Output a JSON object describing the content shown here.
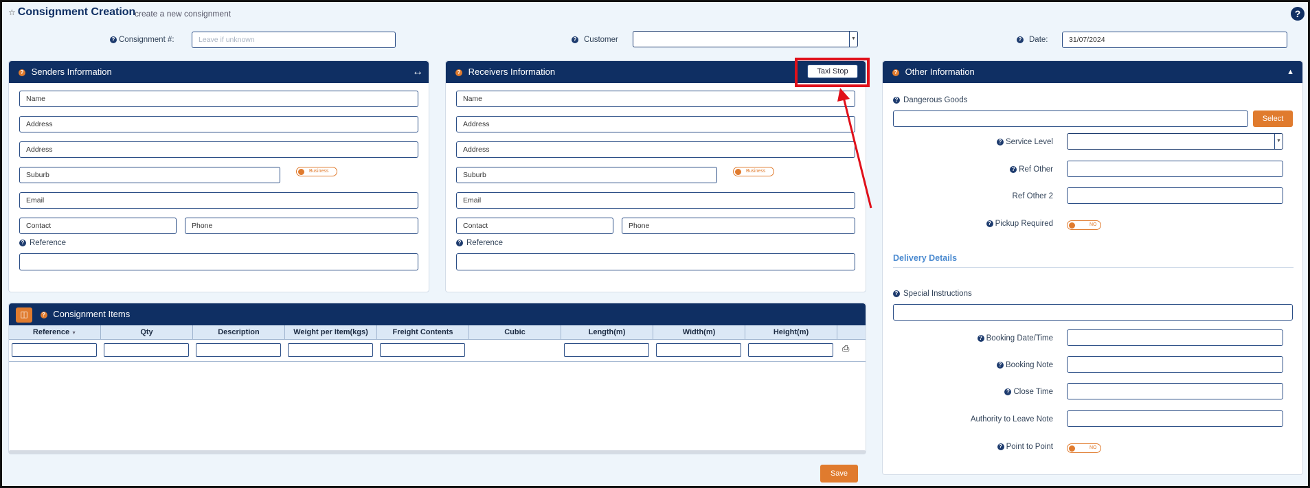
{
  "header": {
    "title": "Consignment Creation",
    "subtitle": "create a new consignment",
    "help": "?"
  },
  "top_fields": {
    "consignment_label": "Consignment #:",
    "consignment_placeholder": "Leave if unknown",
    "customer_label": "Customer",
    "customer_value": "",
    "date_label": "Date:",
    "date_value": "31/07/2024"
  },
  "senders": {
    "title": "Senders Information",
    "expand_icon": "↔",
    "name": "Name",
    "address1": "Address",
    "address2": "Address",
    "suburb": "Suburb",
    "business_toggle": "Business",
    "email": "Email",
    "contact": "Contact",
    "phone": "Phone",
    "reference_label": "Reference"
  },
  "receivers": {
    "title": "Receivers Information",
    "taxi_stop_button": "Taxi Stop",
    "name": "Name",
    "address1": "Address",
    "address2": "Address",
    "suburb": "Suburb",
    "business_toggle": "Business",
    "email": "Email",
    "contact": "Contact",
    "phone": "Phone",
    "reference_label": "Reference"
  },
  "other": {
    "title": "Other Information",
    "collapse_icon": "▲",
    "dangerous_goods_label": "Dangerous Goods",
    "select_button": "Select",
    "service_level_label": "Service Level",
    "ref_other_label": "Ref Other",
    "ref_other2_label": "Ref Other 2",
    "pickup_required_label": "Pickup Required",
    "pickup_toggle": "NO",
    "delivery_details_title": "Delivery Details",
    "special_instructions_label": "Special Instructions",
    "booking_datetime_label": "Booking Date/Time",
    "booking_note_label": "Booking Note",
    "close_time_label": "Close Time",
    "authority_label": "Authority to Leave Note",
    "point_to_point_label": "Point to Point",
    "point_toggle": "NO"
  },
  "items": {
    "title": "Consignment Items",
    "columns": [
      "Reference",
      "Qty",
      "Description",
      "Weight per Item(kgs)",
      "Freight Contents",
      "Cubic",
      "Length(m)",
      "Width(m)",
      "Height(m)"
    ]
  },
  "save_button": "Save",
  "colors": {
    "navy": "#0f2f63",
    "orange": "#e07b2e",
    "highlight": "#e0101a"
  }
}
